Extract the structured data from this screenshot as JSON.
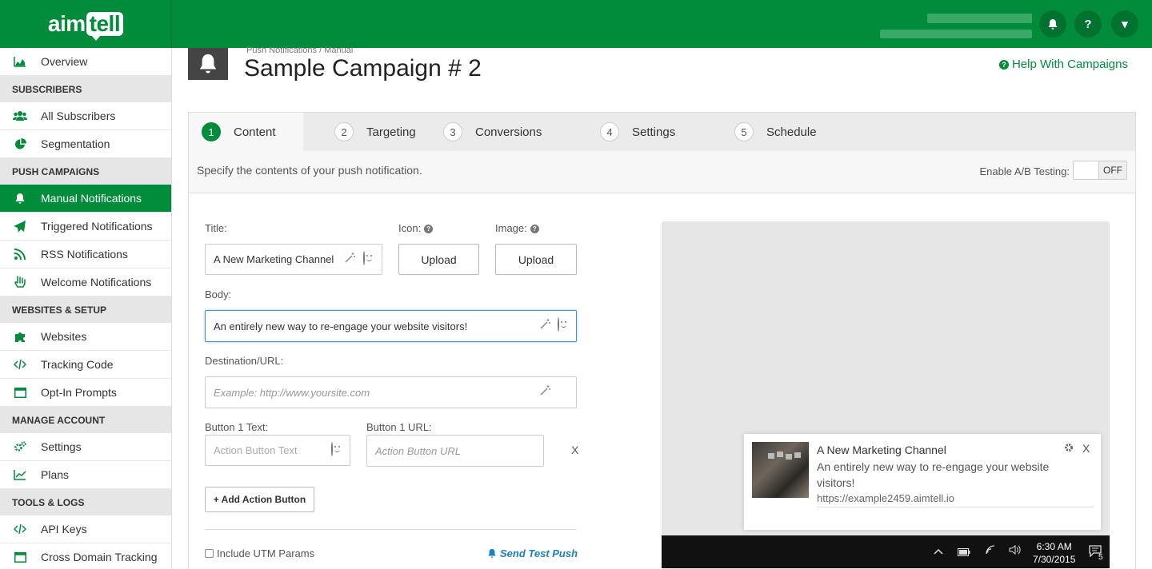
{
  "app": {
    "logo_text": "aim",
    "logo_bubble": "tell"
  },
  "topbar": {
    "question_glyph": "?",
    "caret_glyph": "▾"
  },
  "sidebar": {
    "overview": "Overview",
    "h_subscribers": "SUBSCRIBERS",
    "all_subscribers": "All Subscribers",
    "segmentation": "Segmentation",
    "h_push": "PUSH CAMPAIGNS",
    "manual": "Manual Notifications",
    "triggered": "Triggered Notifications",
    "rss": "RSS Notifications",
    "welcome": "Welcome Notifications",
    "h_websites": "WEBSITES & SETUP",
    "websites": "Websites",
    "tracking": "Tracking Code",
    "optin": "Opt-In Prompts",
    "h_account": "MANAGE ACCOUNT",
    "settings": "Settings",
    "plans": "Plans",
    "h_tools": "TOOLS & LOGS",
    "api": "API Keys",
    "crossdomain": "Cross Domain Tracking"
  },
  "header": {
    "breadcrumb": "Push Notifications  /  Manual",
    "title": "Sample Campaign # 2",
    "help": "Help With Campaigns",
    "help_glyph": "?"
  },
  "tabs": [
    {
      "num": "1",
      "label": "Content"
    },
    {
      "num": "2",
      "label": "Targeting"
    },
    {
      "num": "3",
      "label": "Conversions"
    },
    {
      "num": "4",
      "label": "Settings"
    },
    {
      "num": "5",
      "label": "Schedule"
    }
  ],
  "content": {
    "description": "Specify the contents of your push notification.",
    "ab_label": "Enable A/B Testing:",
    "ab_state": "OFF",
    "title_label": "Title:",
    "title_value": "A New Marketing Channel",
    "icon_label": "Icon:",
    "image_label": "Image:",
    "upload": "Upload",
    "body_label": "Body:",
    "body_value": "An entirely new way to re-engage your website visitors!",
    "dest_label": "Destination/URL:",
    "dest_placeholder": "Example: http://www.yoursite.com",
    "btn1_text_label": "Button 1 Text:",
    "btn1_text_placeholder": "Action Button Text",
    "btn1_url_label": "Button 1 URL:",
    "btn1_url_placeholder": "Action Button URL",
    "remove": "X",
    "add_action": "+ Add Action Button",
    "utm": "Include UTM Params",
    "send_test": "Send Test Push"
  },
  "preview": {
    "title": "A New Marketing Channel",
    "body": "An entirely new way to re-engage your website visitors!",
    "url": "https://example2459.aimtell.io",
    "close": "X",
    "time": "6:30 AM",
    "date": "7/30/2015",
    "notif_count": "5"
  }
}
